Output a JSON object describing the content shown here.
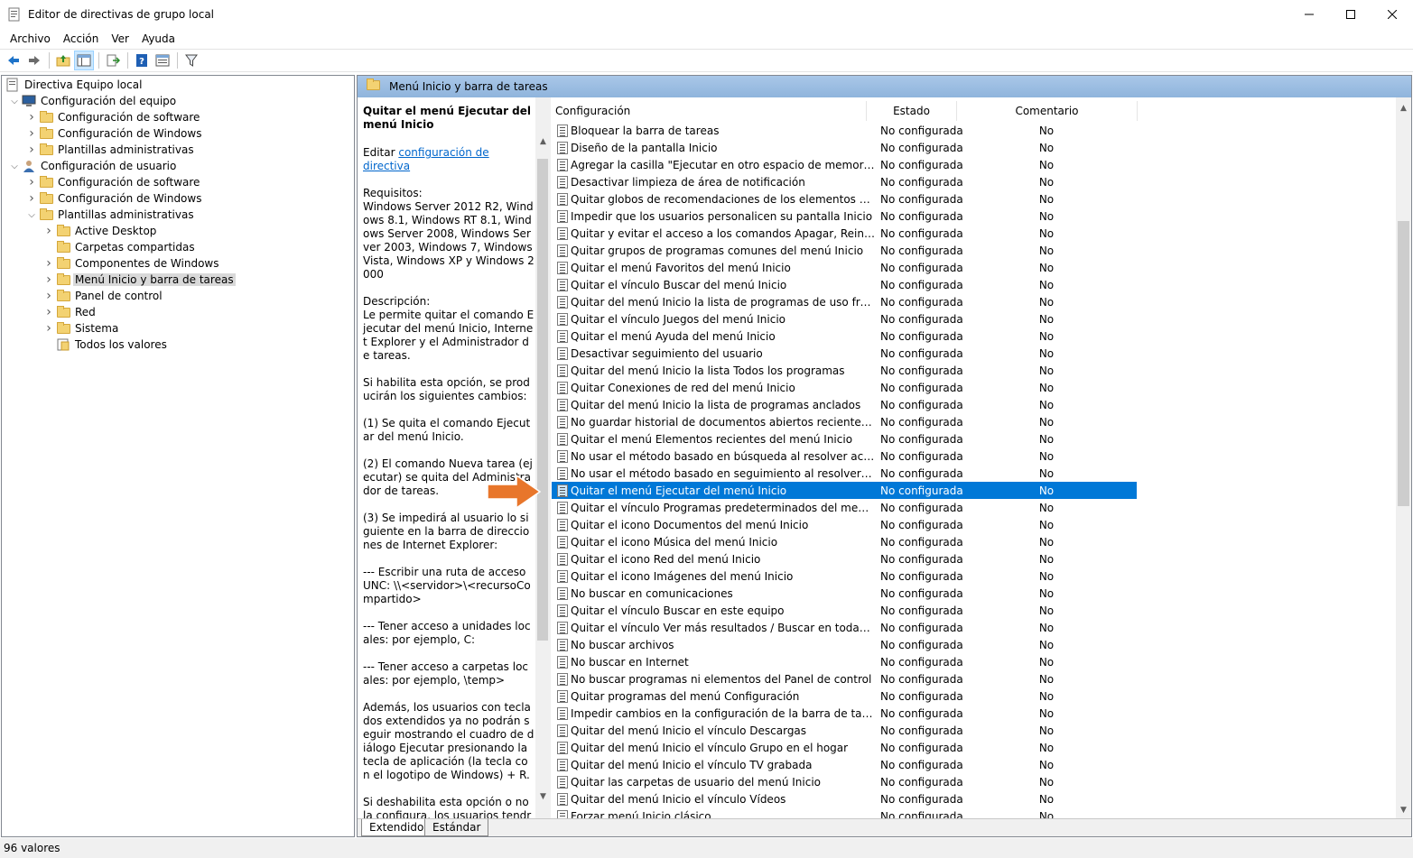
{
  "window": {
    "title": "Editor de directivas de grupo local",
    "minimize_icon": "minimize-icon",
    "maximize_icon": "maximize-icon",
    "close_icon": "close-icon"
  },
  "menu": [
    "Archivo",
    "Acción",
    "Ver",
    "Ayuda"
  ],
  "toolbar": {
    "buttons": [
      "back-arrow-icon",
      "forward-arrow-icon",
      "up-folder-icon",
      "show-hide-tree-icon",
      "export-list-icon",
      "help-icon",
      "properties-icon",
      "filter-icon"
    ]
  },
  "tree": {
    "root": "Directiva Equipo local",
    "items": [
      {
        "label": "Configuración del equipo",
        "level": 1,
        "expander": "expanded",
        "icon": "computer-icon"
      },
      {
        "label": "Configuración de software",
        "level": 2,
        "expander": "collapsed",
        "icon": "folder-icon"
      },
      {
        "label": "Configuración de Windows",
        "level": 2,
        "expander": "collapsed",
        "icon": "folder-icon"
      },
      {
        "label": "Plantillas administrativas",
        "level": 2,
        "expander": "collapsed",
        "icon": "folder-icon"
      },
      {
        "label": "Configuración de usuario",
        "level": 1,
        "expander": "expanded",
        "icon": "user-icon"
      },
      {
        "label": "Configuración de software",
        "level": 2,
        "expander": "collapsed",
        "icon": "folder-icon"
      },
      {
        "label": "Configuración de Windows",
        "level": 2,
        "expander": "collapsed",
        "icon": "folder-icon"
      },
      {
        "label": "Plantillas administrativas",
        "level": 2,
        "expander": "expanded",
        "icon": "folder-icon"
      },
      {
        "label": "Active Desktop",
        "level": 3,
        "expander": "collapsed",
        "icon": "folder-icon"
      },
      {
        "label": "Carpetas compartidas",
        "level": 3,
        "expander": "none",
        "icon": "folder-icon"
      },
      {
        "label": "Componentes de Windows",
        "level": 3,
        "expander": "collapsed",
        "icon": "folder-icon"
      },
      {
        "label": "Menú Inicio y barra de tareas",
        "level": 3,
        "expander": "collapsed",
        "icon": "folder-icon",
        "selected": true
      },
      {
        "label": "Panel de control",
        "level": 3,
        "expander": "collapsed",
        "icon": "folder-icon"
      },
      {
        "label": "Red",
        "level": 3,
        "expander": "collapsed",
        "icon": "folder-icon"
      },
      {
        "label": "Sistema",
        "level": 3,
        "expander": "collapsed",
        "icon": "folder-icon"
      },
      {
        "label": "Todos los valores",
        "level": 3,
        "expander": "none",
        "icon": "all-settings-icon"
      }
    ]
  },
  "right_header": "Menú Inicio y barra de tareas",
  "description": {
    "title": "Quitar el menú Ejecutar del menú Inicio",
    "edit_prefix": "Editar ",
    "edit_link": "configuración de directiva",
    "paragraphs": [
      "Requisitos:\nWindows Server 2012 R2, Windows 8.1, Windows RT 8.1, Windows Server 2008, Windows Server 2003, Windows 7, Windows Vista, Windows XP y Windows 2000",
      "Descripción:\nLe permite quitar el comando Ejecutar del menú Inicio, Internet Explorer y el Administrador de tareas.",
      "Si habilita esta opción, se producirán los siguientes cambios:",
      "(1) Se quita el comando Ejecutar del menú Inicio.",
      "(2) El comando Nueva tarea (ejecutar) se quita del Administrador de tareas.",
      "(3) Se impedirá al usuario lo siguiente en la barra de direcciones de Internet Explorer:",
      "--- Escribir una ruta de acceso UNC: \\\\<servidor>\\<recursoCompartido>",
      "--- Tener acceso a unidades locales: por ejemplo, C:",
      "--- Tener acceso a carpetas locales: por ejemplo, \\temp>",
      "Además, los usuarios con teclados extendidos ya no podrán seguir mostrando el cuadro de diálogo Ejecutar presionando la tecla de aplicación (la tecla con el logotipo de Windows) + R.",
      "Si deshabilita esta opción o no la configura, los usuarios tendrán acceso al comando Ejecutar del"
    ]
  },
  "columns": [
    "Configuración",
    "Estado",
    "Comentario"
  ],
  "rows": [
    {
      "name": "Bloquear la barra de tareas",
      "state": "No configurada",
      "comment": "No"
    },
    {
      "name": "Diseño de la pantalla Inicio",
      "state": "No configurada",
      "comment": "No"
    },
    {
      "name": "Agregar la casilla \"Ejecutar en otro espacio de memoria\" al c...",
      "state": "No configurada",
      "comment": "No"
    },
    {
      "name": "Desactivar limpieza de área de notificación",
      "state": "No configurada",
      "comment": "No"
    },
    {
      "name": "Quitar globos de recomendaciones de los elementos del me...",
      "state": "No configurada",
      "comment": "No"
    },
    {
      "name": "Impedir que los usuarios personalicen su pantalla Inicio",
      "state": "No configurada",
      "comment": "No"
    },
    {
      "name": "Quitar y evitar el acceso a los comandos Apagar, Reiniciar, S...",
      "state": "No configurada",
      "comment": "No"
    },
    {
      "name": "Quitar grupos de programas comunes del menú Inicio",
      "state": "No configurada",
      "comment": "No"
    },
    {
      "name": "Quitar el menú Favoritos del menú Inicio",
      "state": "No configurada",
      "comment": "No"
    },
    {
      "name": "Quitar el vínculo Buscar del menú Inicio",
      "state": "No configurada",
      "comment": "No"
    },
    {
      "name": "Quitar del menú Inicio la lista de programas de uso frecuente",
      "state": "No configurada",
      "comment": "No"
    },
    {
      "name": "Quitar el vínculo Juegos del menú Inicio",
      "state": "No configurada",
      "comment": "No"
    },
    {
      "name": "Quitar el menú Ayuda del menú Inicio",
      "state": "No configurada",
      "comment": "No"
    },
    {
      "name": "Desactivar seguimiento del usuario",
      "state": "No configurada",
      "comment": "No"
    },
    {
      "name": "Quitar del menú Inicio la lista Todos los programas",
      "state": "No configurada",
      "comment": "No"
    },
    {
      "name": "Quitar Conexiones de red del menú Inicio",
      "state": "No configurada",
      "comment": "No"
    },
    {
      "name": "Quitar del menú Inicio la lista de programas anclados",
      "state": "No configurada",
      "comment": "No"
    },
    {
      "name": "No guardar historial de documentos abiertos recientemente",
      "state": "No configurada",
      "comment": "No"
    },
    {
      "name": "Quitar el menú Elementos recientes del menú Inicio",
      "state": "No configurada",
      "comment": "No"
    },
    {
      "name": "No usar el método basado en búsqueda al resolver accesos ...",
      "state": "No configurada",
      "comment": "No"
    },
    {
      "name": "No usar el método basado en seguimiento al resolver acces...",
      "state": "No configurada",
      "comment": "No"
    },
    {
      "name": "Quitar el menú Ejecutar del menú Inicio",
      "state": "No configurada",
      "comment": "No",
      "selected": true
    },
    {
      "name": "Quitar el vínculo Programas predeterminados del menú Inicio",
      "state": "No configurada",
      "comment": "No"
    },
    {
      "name": "Quitar el icono Documentos del menú Inicio",
      "state": "No configurada",
      "comment": "No"
    },
    {
      "name": "Quitar el icono Música del menú Inicio",
      "state": "No configurada",
      "comment": "No"
    },
    {
      "name": "Quitar el icono Red del menú Inicio",
      "state": "No configurada",
      "comment": "No"
    },
    {
      "name": "Quitar el icono Imágenes del menú Inicio",
      "state": "No configurada",
      "comment": "No"
    },
    {
      "name": "No buscar en comunicaciones",
      "state": "No configurada",
      "comment": "No"
    },
    {
      "name": "Quitar el vínculo Buscar en este equipo",
      "state": "No configurada",
      "comment": "No"
    },
    {
      "name": "Quitar el vínculo Ver más resultados / Buscar en todas partes",
      "state": "No configurada",
      "comment": "No"
    },
    {
      "name": "No buscar archivos",
      "state": "No configurada",
      "comment": "No"
    },
    {
      "name": "No buscar en Internet",
      "state": "No configurada",
      "comment": "No"
    },
    {
      "name": "No buscar programas ni elementos del Panel de control",
      "state": "No configurada",
      "comment": "No"
    },
    {
      "name": "Quitar programas del menú Configuración",
      "state": "No configurada",
      "comment": "No"
    },
    {
      "name": "Impedir cambios en la configuración de la barra de tareas y ...",
      "state": "No configurada",
      "comment": "No"
    },
    {
      "name": "Quitar del menú Inicio el vínculo Descargas",
      "state": "No configurada",
      "comment": "No"
    },
    {
      "name": "Quitar del menú Inicio el vínculo Grupo en el hogar",
      "state": "No configurada",
      "comment": "No"
    },
    {
      "name": "Quitar del menú Inicio el vínculo TV grabada",
      "state": "No configurada",
      "comment": "No"
    },
    {
      "name": "Quitar las carpetas de usuario del menú Inicio",
      "state": "No configurada",
      "comment": "No"
    },
    {
      "name": "Quitar del menú Inicio el vínculo Vídeos",
      "state": "No configurada",
      "comment": "No"
    },
    {
      "name": "Forzar menú Inicio clásico",
      "state": "No configurada",
      "comment": "No"
    }
  ],
  "tabs": [
    "Extendido",
    "Estándar"
  ],
  "status": "96 valores",
  "colors": {
    "selection": "#0078d7",
    "header_band": "#a9c7e8",
    "arrow": "#e8762b"
  }
}
